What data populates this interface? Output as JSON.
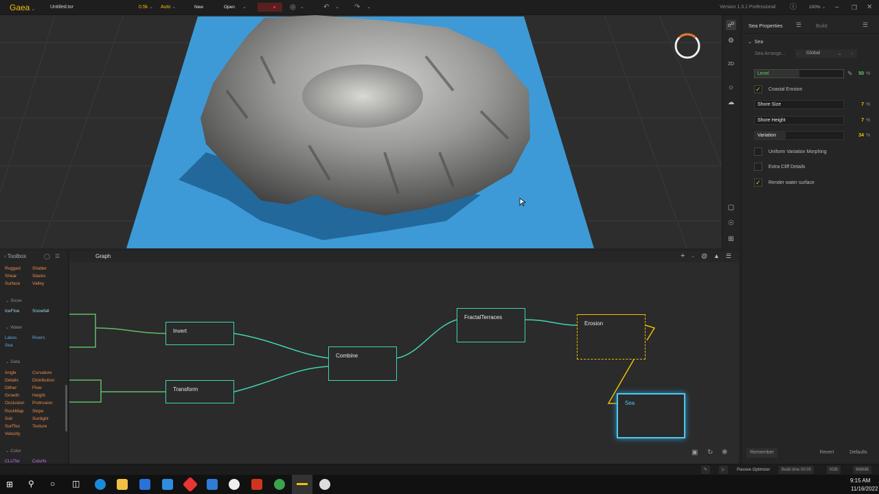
{
  "topbar": {
    "app_name": "Gaea",
    "file_name": "Untitled.tor",
    "resolution": "0.5k",
    "auto_label": "Auto",
    "new_label": "New",
    "open_label": "Open",
    "version": "Version 1.3.1 Professional",
    "zoom": "100%"
  },
  "toolbox": {
    "title": "Toolbox",
    "items_top": [
      "Rugged",
      "Shatter",
      "Shear",
      "Stacks",
      "Surface",
      "Valley"
    ],
    "sections": [
      {
        "name": "Snow",
        "items": [
          "IceFloe",
          "Snowfall"
        ]
      },
      {
        "name": "Water",
        "items": [
          "Lakes",
          "Rivers",
          "Sea"
        ]
      },
      {
        "name": "Data",
        "items": [
          "Angle",
          "Curvature",
          "Details",
          "Distribution",
          "Dither",
          "Flow",
          "Growth",
          "Height",
          "Occlusion",
          "Protrusion",
          "RockMap",
          "Slope",
          "Soil",
          "Sunlight",
          "SurfTex",
          "Texture",
          "Velocity"
        ]
      },
      {
        "name": "Color",
        "items": [
          "CLUTer",
          "Colorfx"
        ]
      }
    ]
  },
  "graph": {
    "tab_label": "Graph",
    "nodes": {
      "invert": "Invert",
      "transform": "Transform",
      "combine": "Combine",
      "fractal_terraces": "FractalTerraces",
      "erosion": "Erosion",
      "sea": "Sea"
    }
  },
  "properties": {
    "title": "Sea Properties",
    "build_tab": "Build",
    "section": "Sea",
    "arrangement_label": "Sea Arrange...",
    "arrangement_value": "Global",
    "level": {
      "label": "Level",
      "value": "50",
      "unit": "%"
    },
    "coastal_erosion": {
      "label": "Coastal Erosion",
      "checked": true
    },
    "shore_size": {
      "label": "Shore Size",
      "value": "7",
      "unit": "%"
    },
    "shore_height": {
      "label": "Shore Height",
      "value": "7",
      "unit": "%"
    },
    "variation": {
      "label": "Variation",
      "value": "34",
      "unit": "%"
    },
    "uniform_variation": {
      "label": "Uniform Variation Morphing",
      "checked": false
    },
    "extra_cliff": {
      "label": "Extra Cliff Details",
      "checked": false
    },
    "render_water": {
      "label": "Render water surface",
      "checked": true
    },
    "remember_label": "Remember",
    "revert_label": "Revert",
    "defaults_label": "Defaults"
  },
  "viewport_tools": {
    "mode_2d": "2D"
  },
  "statusbar": {
    "optimizer": "Passive Optimizer",
    "build_time": "Build time 00:00",
    "gpu": "0GB",
    "memory": "968MB"
  },
  "taskbar": {
    "time": "9:15 AM",
    "date": "11/16/2022"
  },
  "colors": {
    "accent": "#f2c100",
    "node_border": "#3fd6b4",
    "sea_node": "#4fc9ee",
    "water": "#3d9ad6",
    "toolbox_orange": "#ef8b4a",
    "toolbox_blue": "#5aa9e6"
  }
}
